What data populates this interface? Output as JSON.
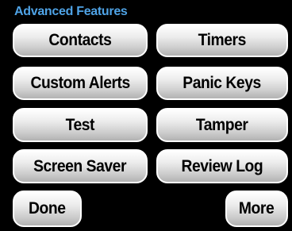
{
  "screen": {
    "title": "Advanced Features",
    "title_color": "#4fa3e6"
  },
  "buttons": {
    "contacts": "Contacts",
    "timers": "Timers",
    "custom_alerts": "Custom Alerts",
    "panic_keys": "Panic Keys",
    "test": "Test",
    "tamper": "Tamper",
    "screen_saver": "Screen Saver",
    "review_log": "Review Log"
  },
  "footer": {
    "done": "Done",
    "more": "More"
  }
}
